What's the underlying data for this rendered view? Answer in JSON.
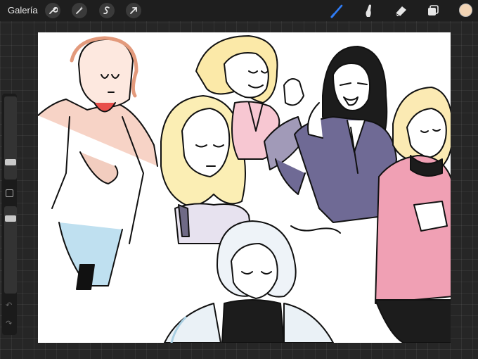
{
  "toolbar": {
    "gallery_label": "Galería",
    "left_tools": [
      {
        "name": "wrench-icon"
      },
      {
        "name": "magic-wand-icon"
      },
      {
        "name": "selection-icon"
      },
      {
        "name": "transform-arrow-icon"
      }
    ],
    "right_tools": [
      {
        "name": "brush-icon",
        "active": true
      },
      {
        "name": "smudge-icon"
      },
      {
        "name": "eraser-icon"
      },
      {
        "name": "layers-icon"
      }
    ],
    "current_color": "#f3d5b5",
    "accent_color": "#2f7cf6"
  },
  "sidebar": {
    "brush_size_level": 0.72,
    "opacity_level": 0.3,
    "undo_icon": "undo-icon",
    "redo_icon": "redo-icon"
  },
  "canvas": {
    "content": "sketch-illustration"
  }
}
